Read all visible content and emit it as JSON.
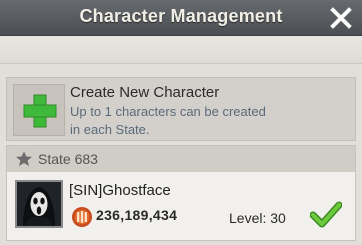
{
  "header": {
    "title": "Character Management",
    "close_icon": "close-x-icon"
  },
  "create": {
    "title": "Create New Character",
    "description": "Up to 1 characters can be created in each State.",
    "icon": "plus-icon",
    "accent": "#3fb93a"
  },
  "state": {
    "label": "State 683",
    "icon": "star-icon"
  },
  "character": {
    "name": "[SIN]Ghostface",
    "power": "236,189,434",
    "power_icon": "power-crest-icon",
    "level": "Level: 30",
    "selected_icon": "checkmark-icon",
    "selected_color": "#5fb63a"
  }
}
